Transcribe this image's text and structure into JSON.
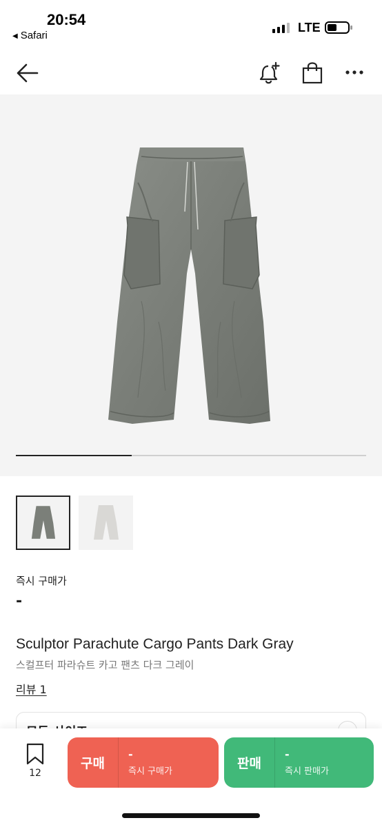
{
  "status_bar": {
    "time": "20:54",
    "back_app": "Safari",
    "network": "LTE"
  },
  "nav": {
    "icons": [
      "back-arrow-icon",
      "bell-plus-icon",
      "shopping-bag-icon",
      "more-icon"
    ]
  },
  "gallery": {
    "progress": 0.33,
    "thumbnails": [
      {
        "name": "thumbnail-dark-gray",
        "color": "#7b7f79",
        "selected": true
      },
      {
        "name": "thumbnail-light-gray",
        "color": "#d9d8d5",
        "selected": false
      }
    ]
  },
  "product": {
    "price_label": "즉시 구매가",
    "price_value": "-",
    "title_en": "Sculptor Parachute Cargo Pants Dark Gray",
    "title_ko": "스컬프터 파라슈트 카고 팬츠 다크 그레이",
    "review_link": "리뷰 1"
  },
  "size_select": {
    "label": "모든 사이즈"
  },
  "bottom_bar": {
    "bookmark_count": "12",
    "buy": {
      "label": "구매",
      "price": "-",
      "sub": "즉시 구매가",
      "color": "#ef6253"
    },
    "sell": {
      "label": "판매",
      "price": "-",
      "sub": "즉시 판매가",
      "color": "#41b979"
    }
  }
}
